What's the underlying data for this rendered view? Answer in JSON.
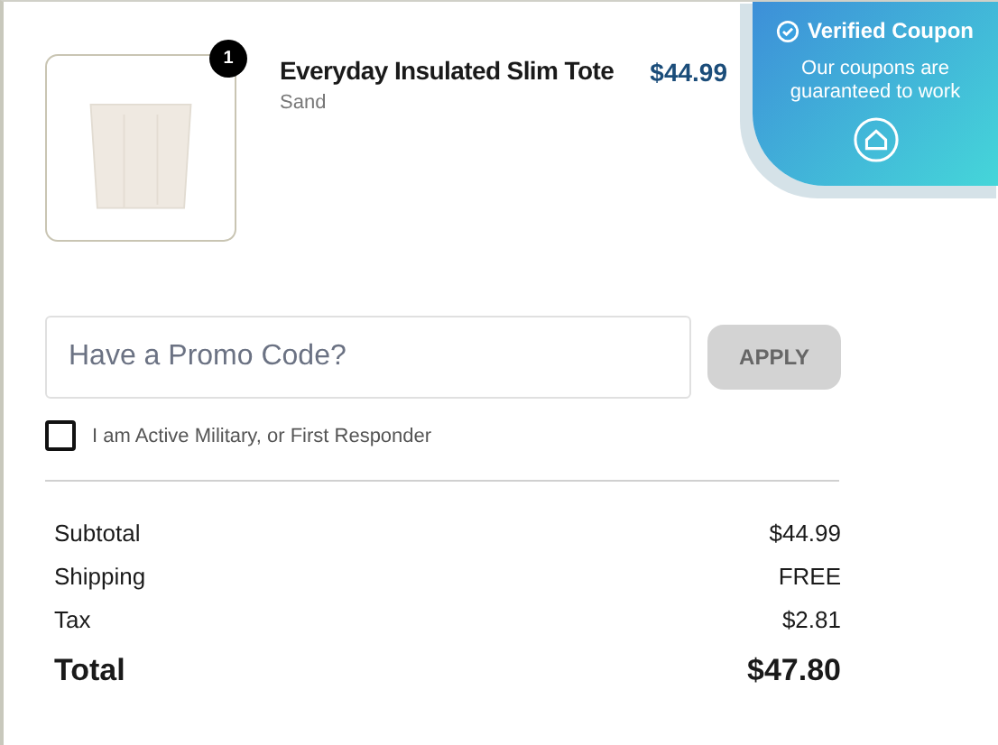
{
  "cart_item": {
    "quantity": "1",
    "name": "Everyday Insulated Slim Tote",
    "variant": "Sand",
    "price": "$44.99"
  },
  "coupon_popup": {
    "title": "Verified Coupon",
    "message": "Our coupons are guaranteed to work"
  },
  "promo": {
    "placeholder": "Have a Promo Code?",
    "button": "APPLY",
    "button_disabled": true
  },
  "military_checkbox": {
    "label": "I am Active Military, or First Responder",
    "checked": false
  },
  "summary": [
    {
      "label": "Subtotal",
      "value": "$44.99",
      "kind": "line"
    },
    {
      "label": "Shipping",
      "value": "FREE",
      "kind": "line"
    },
    {
      "label": "Tax",
      "value": "$2.81",
      "kind": "line"
    },
    {
      "label": "Total",
      "value": "$47.80",
      "kind": "total"
    }
  ]
}
